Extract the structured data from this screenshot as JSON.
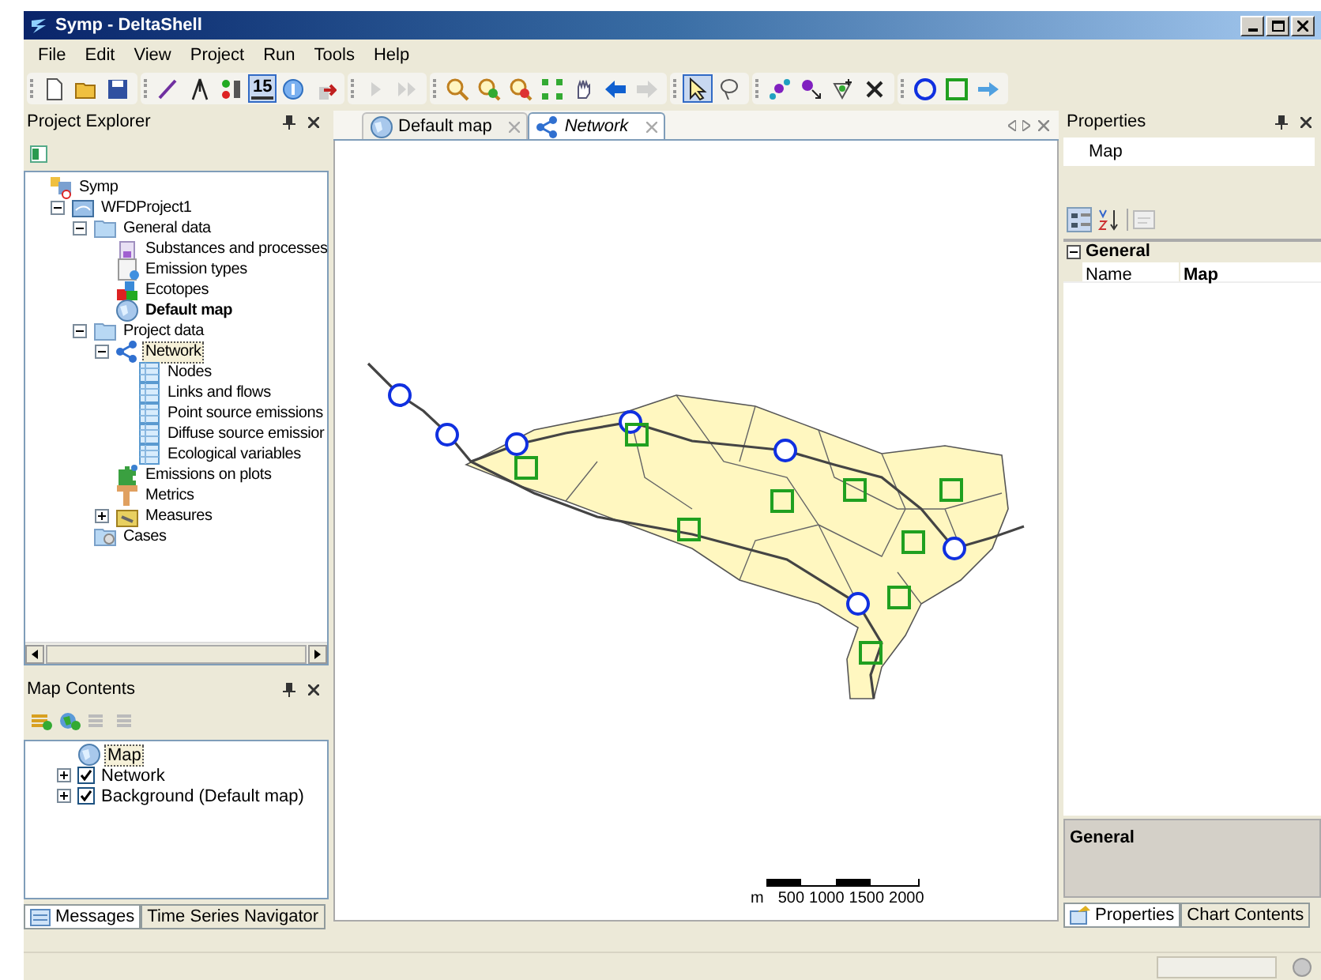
{
  "window": {
    "title": "Symp - DeltaShell"
  },
  "menu": [
    "File",
    "Edit",
    "View",
    "Project",
    "Run",
    "Tools",
    "Help"
  ],
  "toolbar": [
    [
      {
        "kind": "new",
        "pressed": false,
        "disabled": false
      },
      {
        "kind": "open",
        "pressed": false,
        "disabled": false
      },
      {
        "kind": "save",
        "pressed": false,
        "disabled": false
      }
    ],
    [
      {
        "kind": "measure",
        "pressed": false,
        "disabled": false
      },
      {
        "kind": "north",
        "pressed": false,
        "disabled": false
      },
      {
        "kind": "label",
        "pressed": false,
        "disabled": false
      },
      {
        "kind": "calendar",
        "text": "15",
        "pressed": true,
        "disabled": false
      },
      {
        "kind": "info",
        "pressed": false,
        "disabled": false
      },
      {
        "kind": "export",
        "pressed": false,
        "disabled": false
      }
    ],
    [
      {
        "kind": "play",
        "pressed": false,
        "disabled": true
      },
      {
        "kind": "fastforward",
        "pressed": false,
        "disabled": true
      }
    ],
    [
      {
        "kind": "zoom",
        "pressed": false,
        "disabled": false
      },
      {
        "kind": "zoomin",
        "pressed": false,
        "disabled": false
      },
      {
        "kind": "zoomout",
        "pressed": false,
        "disabled": false
      },
      {
        "kind": "fit",
        "pressed": false,
        "disabled": false
      },
      {
        "kind": "pan",
        "pressed": false,
        "disabled": false
      },
      {
        "kind": "back",
        "pressed": false,
        "disabled": false
      },
      {
        "kind": "forward",
        "pressed": false,
        "disabled": true
      }
    ],
    [
      {
        "kind": "select",
        "pressed": true,
        "disabled": false
      },
      {
        "kind": "lasso",
        "pressed": false,
        "disabled": false
      }
    ],
    [
      {
        "kind": "addnode",
        "pressed": false,
        "disabled": false
      },
      {
        "kind": "movenode",
        "pressed": false,
        "disabled": false
      },
      {
        "kind": "addpoint",
        "pressed": false,
        "disabled": false
      },
      {
        "kind": "delete",
        "pressed": false,
        "disabled": false
      }
    ],
    [
      {
        "kind": "circle",
        "pressed": false,
        "disabled": false
      },
      {
        "kind": "square",
        "pressed": false,
        "disabled": false
      },
      {
        "kind": "arrow",
        "pressed": false,
        "disabled": false
      }
    ]
  ],
  "project_explorer": {
    "title": "Project Explorer",
    "tree": [
      {
        "label": "Symp",
        "kind": "project",
        "bold": false,
        "selected": false,
        "children": [
          {
            "label": "WFDProject1",
            "kind": "db",
            "bold": false,
            "selected": false,
            "expanded": true,
            "children": [
              {
                "label": "General data",
                "kind": "folder",
                "bold": false,
                "selected": false,
                "expanded": true,
                "children": [
                  {
                    "label": "Substances and processes",
                    "kind": "flask",
                    "bold": false,
                    "selected": false
                  },
                  {
                    "label": "Emission types",
                    "kind": "doc",
                    "bold": false,
                    "selected": false
                  },
                  {
                    "label": "Ecotopes",
                    "kind": "blocks",
                    "bold": false,
                    "selected": false
                  },
                  {
                    "label": "Default map",
                    "kind": "globe",
                    "bold": true,
                    "selected": false
                  }
                ]
              },
              {
                "label": "Project data",
                "kind": "folder",
                "bold": false,
                "selected": false,
                "expanded": true,
                "children": [
                  {
                    "label": "Network",
                    "kind": "network",
                    "bold": false,
                    "selected": true,
                    "expanded": true,
                    "children": [
                      {
                        "label": "Nodes",
                        "kind": "table",
                        "bold": false,
                        "selected": false
                      },
                      {
                        "label": "Links and flows",
                        "kind": "table",
                        "bold": false,
                        "selected": false
                      },
                      {
                        "label": "Point source emissions",
                        "kind": "table",
                        "bold": false,
                        "selected": false
                      },
                      {
                        "label": "Diffuse source emissior",
                        "kind": "table",
                        "bold": false,
                        "selected": false
                      },
                      {
                        "label": "Ecological variables",
                        "kind": "table",
                        "bold": false,
                        "selected": false
                      }
                    ]
                  },
                  {
                    "label": "Emissions on plots",
                    "kind": "puzzle",
                    "bold": false,
                    "selected": false
                  },
                  {
                    "label": "Metrics",
                    "kind": "ruler",
                    "bold": false,
                    "selected": false
                  },
                  {
                    "label": "Measures",
                    "kind": "tools",
                    "bold": false,
                    "selected": false,
                    "expanded": false
                  }
                ]
              },
              {
                "label": "Cases",
                "kind": "gearfolder",
                "bold": false,
                "selected": false
              }
            ]
          }
        ]
      }
    ]
  },
  "map_contents": {
    "title": "Map Contents",
    "tree": [
      {
        "label": "Map",
        "kind": "globe",
        "selected": true,
        "children": [
          {
            "label": "Network",
            "checked": true,
            "selected": false
          },
          {
            "label": "Background (Default map)",
            "checked": true,
            "selected": false
          }
        ]
      }
    ]
  },
  "document_tabs": [
    {
      "label": "Default map",
      "kind": "globe",
      "selected": false
    },
    {
      "label": "Network",
      "kind": "network",
      "selected": true
    }
  ],
  "scale_bar": [
    "m",
    "500",
    "1000",
    "1500",
    "2000"
  ],
  "properties": {
    "title": "Properties",
    "object": "Map",
    "category": "General",
    "rows": [
      {
        "name": "Name",
        "value": "Map"
      }
    ],
    "description_title": "General"
  },
  "bottom_tabs": [
    {
      "label": "Messages",
      "selected": true
    },
    {
      "label": "Time Series Navigator",
      "selected": false
    }
  ],
  "right_tabs": [
    {
      "label": "Properties",
      "selected": true
    },
    {
      "label": "Chart Contents",
      "selected": false
    }
  ]
}
